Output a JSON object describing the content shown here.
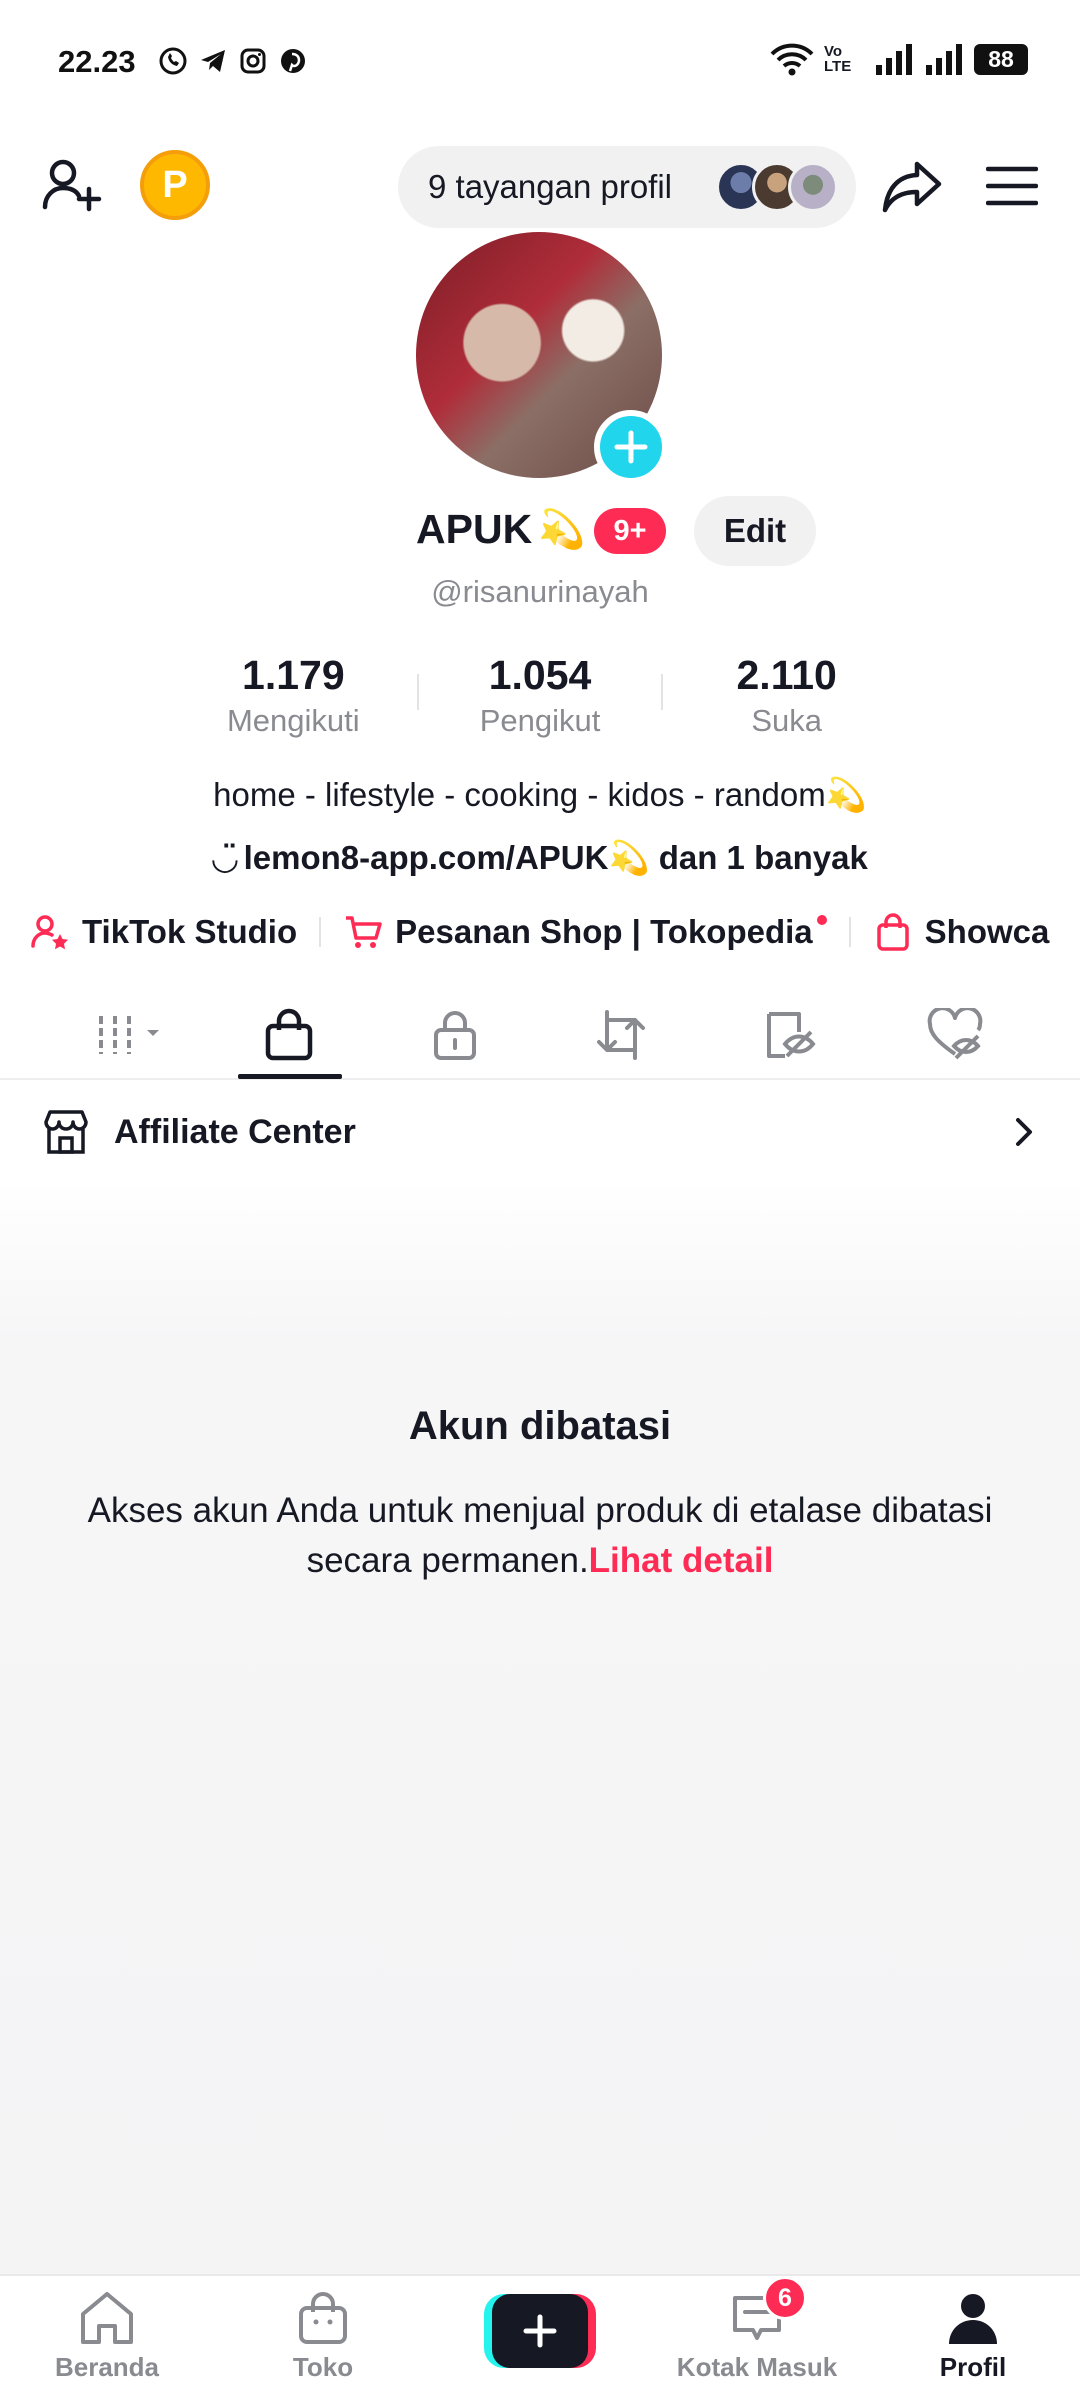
{
  "status_bar": {
    "time": "22.23",
    "app_icons": [
      "whatsapp-icon",
      "telegram-icon",
      "instagram-icon",
      "pinterest-icon"
    ],
    "battery": "88",
    "network_label": "Vo LTE"
  },
  "topbar": {
    "coin_letter": "P",
    "profile_views": "9 tayangan profil"
  },
  "profile": {
    "display_name": "APUK",
    "badge": "9+",
    "edit_label": "Edit",
    "username": "@risanurinayah",
    "stats": [
      {
        "value": "1.179",
        "label": "Mengikuti"
      },
      {
        "value": "1.054",
        "label": "Pengikut"
      },
      {
        "value": "2.110",
        "label": "Suka"
      }
    ],
    "bio": "home - lifestyle - cooking - kidos - random💫",
    "link": "lemon8-app.com/APUK💫 dan 1 banyak"
  },
  "shortcuts": [
    {
      "label": "TikTok Studio",
      "icon": "user-star-icon"
    },
    {
      "label": "Pesanan Shop | Tokopedia",
      "icon": "cart-icon"
    },
    {
      "label": "Showca",
      "icon": "shopping-bag-icon"
    }
  ],
  "tabs": [
    "grid-icon",
    "shopping-bag-icon",
    "lock-icon",
    "repost-icon",
    "hidden-post-icon",
    "liked-hidden-icon"
  ],
  "affiliate": {
    "label": "Affiliate Center"
  },
  "restriction": {
    "title": "Akun dibatasi",
    "message": "Akses akun Anda untuk menjual produk di etalase dibatasi secara permanen.",
    "link": "Lihat detail"
  },
  "bottom_nav": [
    {
      "label": "Beranda",
      "icon": "home-icon"
    },
    {
      "label": "Toko",
      "icon": "shop-bag-icon"
    },
    {
      "label": "",
      "icon": "plus-icon"
    },
    {
      "label": "Kotak Masuk",
      "icon": "inbox-icon",
      "badge": "6"
    },
    {
      "label": "Profil",
      "icon": "profile-icon"
    }
  ],
  "colors": {
    "accent": "#fe2c55",
    "cyan": "#25f4ee",
    "text": "#161823",
    "muted": "#8a8b91"
  }
}
